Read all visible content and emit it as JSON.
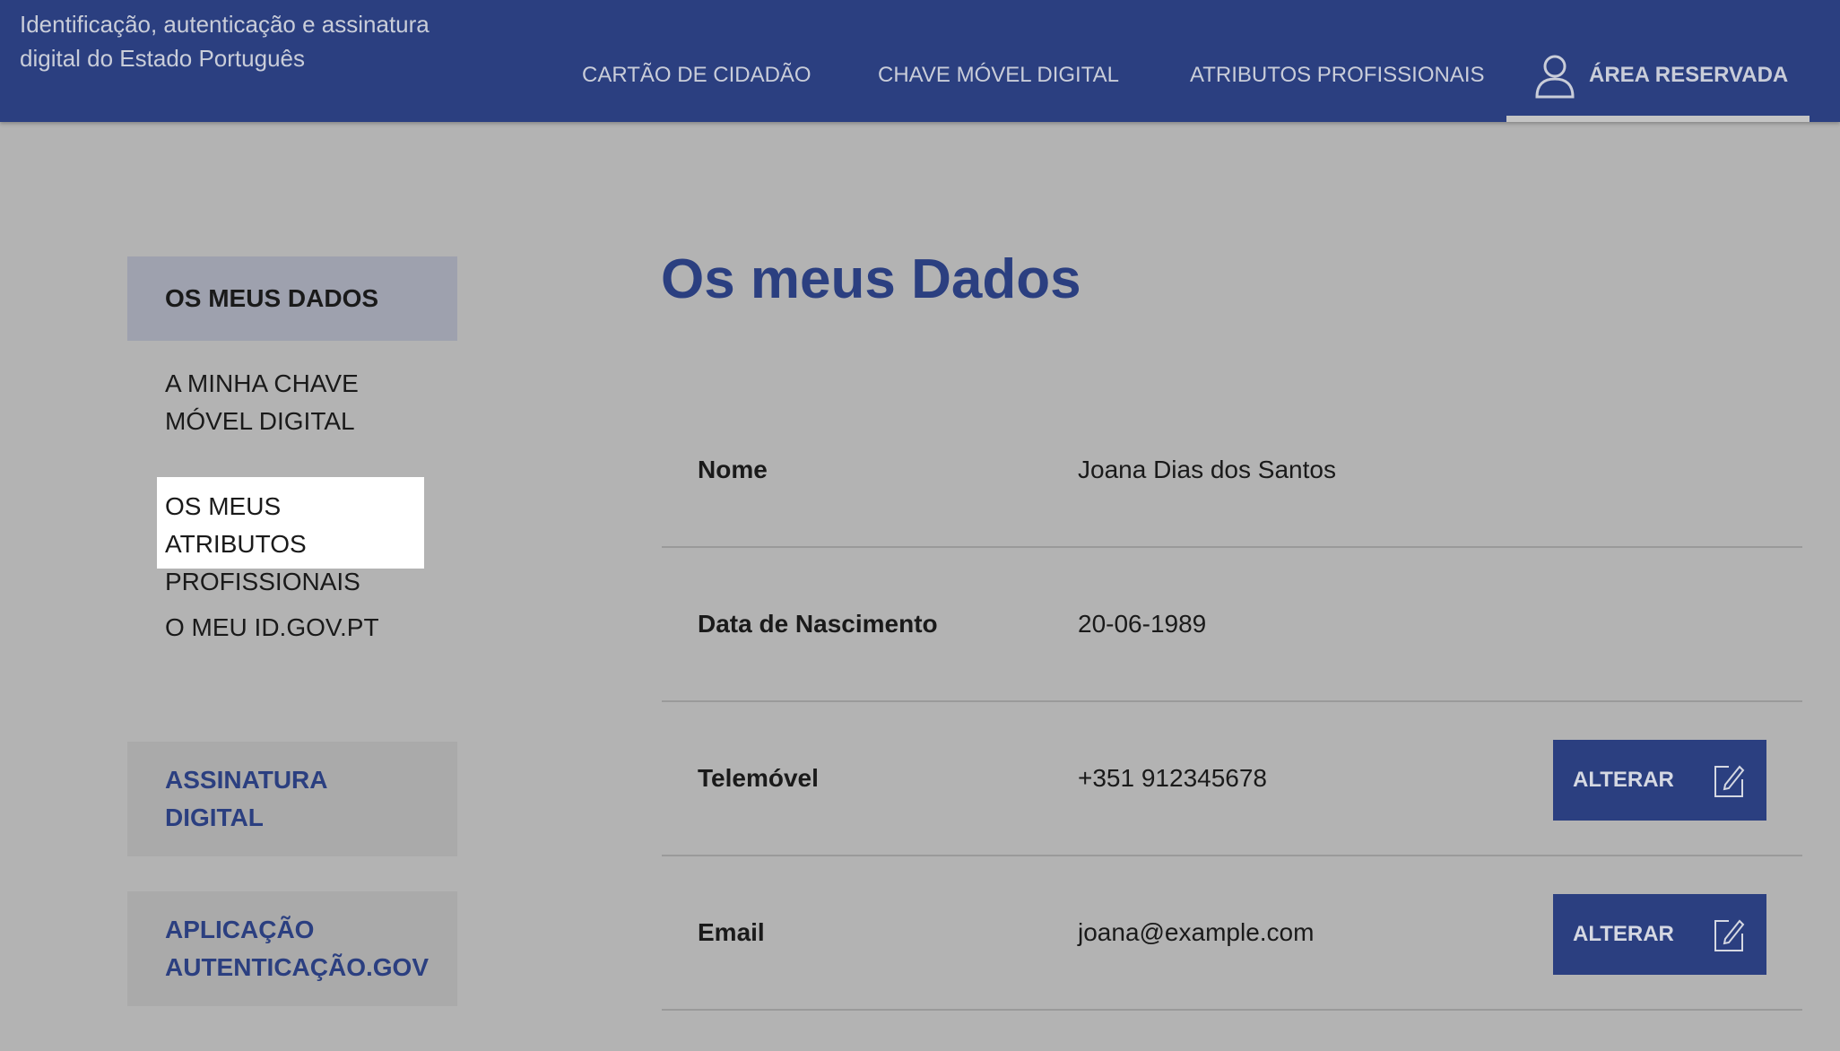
{
  "header": {
    "tagline": "Identificação, autenticação e assinatura digital do Estado Português",
    "nav": {
      "cartao": "CARTÃO DE CIDADÃO",
      "chave": "CHAVE MÓVEL DIGITAL",
      "atributos": "ATRIBUTOS PROFISSIONAIS",
      "area": "ÁREA RESERVADA"
    }
  },
  "sidebar": {
    "items": [
      {
        "label": "OS MEUS DADOS",
        "active": true
      },
      {
        "label": "A MINHA CHAVE MÓVEL DIGITAL"
      },
      {
        "label": "OS MEUS ATRIBUTOS PROFISSIONAIS",
        "highlighted": true
      },
      {
        "label": "O MEU ID.GOV.PT"
      }
    ],
    "boxes": [
      {
        "label": "ASSINATURA DIGITAL"
      },
      {
        "label": "APLICAÇÃO AUTENTICAÇÃO.GOV"
      }
    ]
  },
  "main": {
    "title": "Os meus Dados",
    "rows": [
      {
        "label": "Nome",
        "value": "Joana Dias dos Santos"
      },
      {
        "label": "Data de Nascimento",
        "value": "20-06-1989"
      },
      {
        "label": "Telemóvel",
        "value": "+351 912345678",
        "button": "ALTERAR"
      },
      {
        "label": "Email",
        "value": "joana@example.com",
        "button": "ALTERAR"
      }
    ]
  },
  "colors": {
    "brand": "#2b3f80",
    "background": "#b3b3b3",
    "active_item": "#9ea1ae"
  },
  "icons": {
    "user": "user-icon",
    "edit": "edit-icon"
  }
}
